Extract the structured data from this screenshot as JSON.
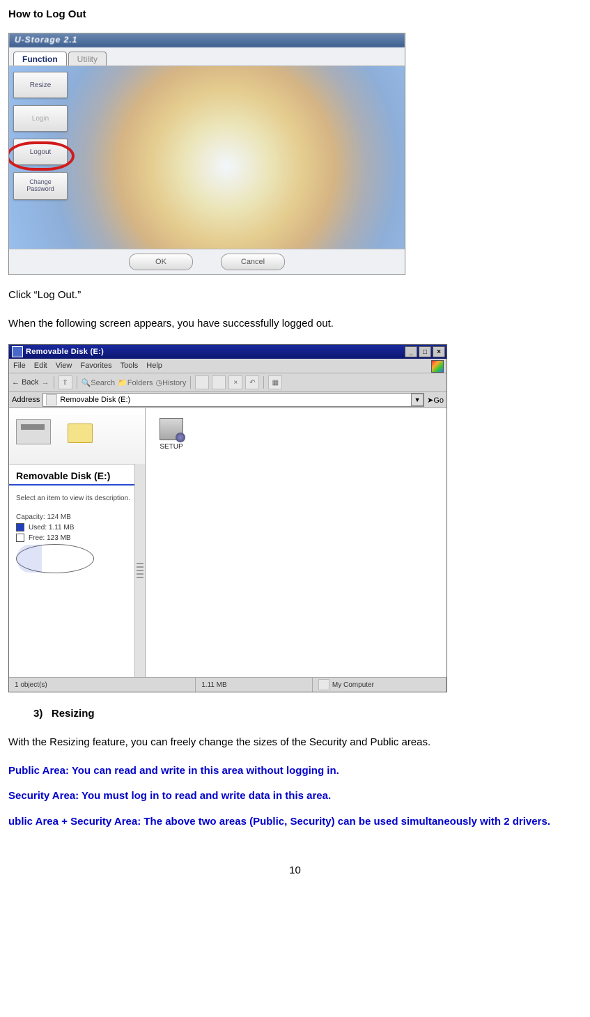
{
  "heading_logout": "How to Log Out",
  "fig1": {
    "title": "U-Storage 2.1",
    "tab_function": "Function",
    "tab_utility": "Utility",
    "btn_resize": "Resize",
    "btn_login": "Login",
    "btn_logout": "Logout",
    "btn_changepw": "Change\nPassword",
    "btn_ok": "OK",
    "btn_cancel": "Cancel"
  },
  "para_click": "Click “Log Out.”",
  "para_success": "When the following screen appears, you have successfully logged out.",
  "fig2": {
    "title": "Removable Disk (E:)",
    "menu": {
      "file": "File",
      "edit": "Edit",
      "view": "View",
      "favorites": "Favorites",
      "tools": "Tools",
      "help": "Help"
    },
    "toolbar": {
      "back": "Back",
      "search": "Search",
      "folders": "Folders",
      "history": "History"
    },
    "addr_label": "Address",
    "addr_value": "Removable Disk (E:)",
    "go": "Go",
    "panel_title": "Removable Disk (E:)",
    "panel_desc": "Select an item to view its description.",
    "capacity": "Capacity: 124 MB",
    "used": "Used: 1.11 MB",
    "free": "Free: 123 MB",
    "setup": "SETUP",
    "status_left": "1 object(s)",
    "status_mid": "1.11 MB",
    "status_right": "My Computer"
  },
  "heading_resizing_num": "3)",
  "heading_resizing": "Resizing",
  "para_resizing": "With the Resizing feature, you can freely change the sizes of the Security and Public areas.",
  "blue_public": "Public Area: You can read and write in this area without logging in.",
  "blue_security": "Security Area: You must log in to read and write data in this area.",
  "blue_combo": "ublic Area + Security Area: The above two areas (Public, Security) can be used simultaneously with 2 drivers.",
  "page_number": "10"
}
